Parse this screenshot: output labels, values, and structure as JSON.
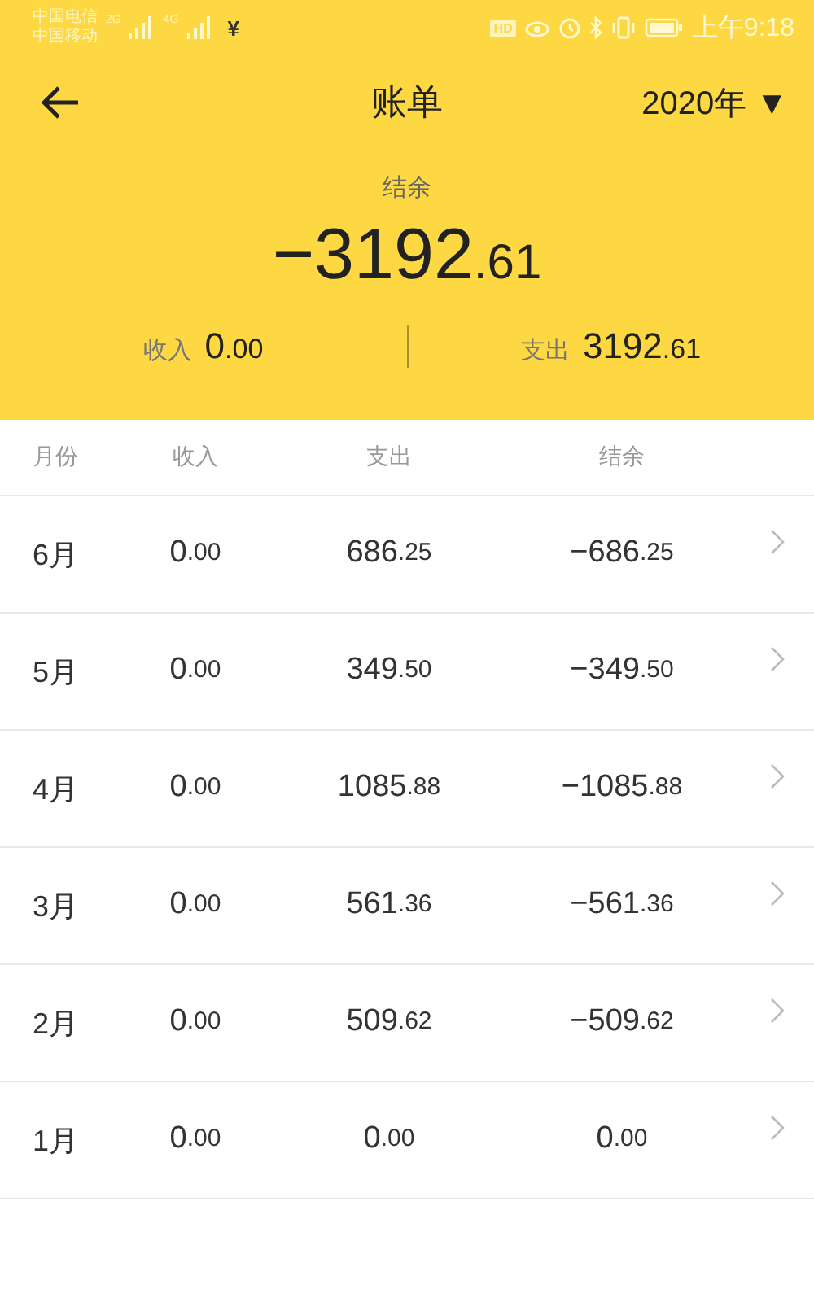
{
  "status_bar": {
    "carriers": [
      "中国电信",
      "中国移动"
    ],
    "networks": [
      "2G",
      "4G"
    ],
    "notification": "¥",
    "hd_badge": "HD",
    "time": "上午9:18"
  },
  "nav": {
    "title": "账单",
    "year": "2020年",
    "dropdown": "▼"
  },
  "summary": {
    "balance_label": "结余",
    "balance": "−3192.61",
    "income_label": "收入",
    "income": "0.00",
    "expense_label": "支出",
    "expense": "3192.61"
  },
  "table": {
    "columns": [
      "月份",
      "收入",
      "支出",
      "结余"
    ],
    "rows": [
      {
        "month": "6月",
        "income": "0.00",
        "expense": "686.25",
        "balance": "−686.25"
      },
      {
        "month": "5月",
        "income": "0.00",
        "expense": "349.50",
        "balance": "−349.50"
      },
      {
        "month": "4月",
        "income": "0.00",
        "expense": "1085.88",
        "balance": "−1085.88"
      },
      {
        "month": "3月",
        "income": "0.00",
        "expense": "561.36",
        "balance": "−561.36"
      },
      {
        "month": "2月",
        "income": "0.00",
        "expense": "509.62",
        "balance": "−509.62"
      },
      {
        "month": "1月",
        "income": "0.00",
        "expense": "0.00",
        "balance": "0.00"
      }
    ]
  }
}
